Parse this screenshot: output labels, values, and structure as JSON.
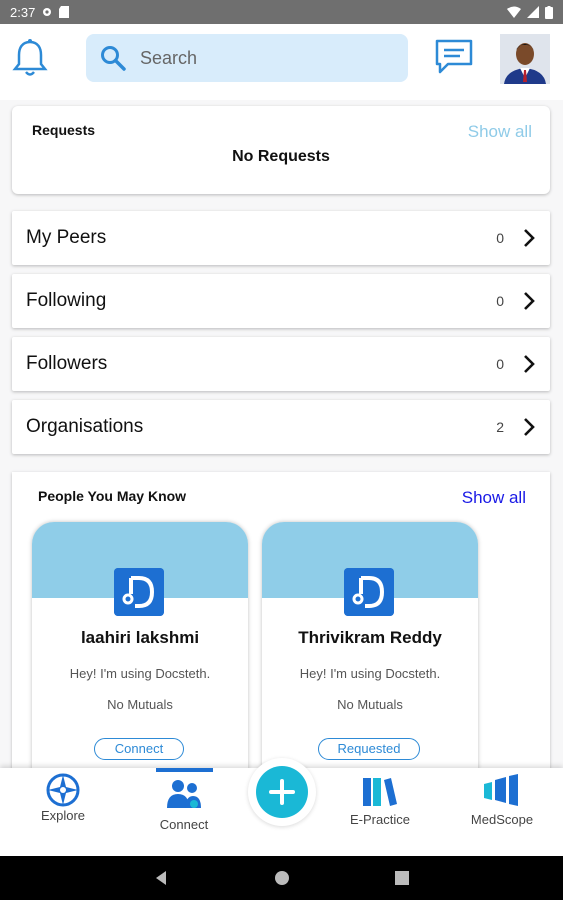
{
  "status_bar": {
    "time": "2:37"
  },
  "header": {
    "search_placeholder": "Search"
  },
  "requests": {
    "title": "Requests",
    "show_all": "Show all",
    "empty_text": "No Requests"
  },
  "connections": [
    {
      "label": "My Peers",
      "count": "0"
    },
    {
      "label": "Following",
      "count": "0"
    },
    {
      "label": "Followers",
      "count": "0"
    },
    {
      "label": "Organisations",
      "count": "2"
    }
  ],
  "people_you_may_know": {
    "title": "People You May Know",
    "show_all": "Show all",
    "people": [
      {
        "name": "laahiri lakshmi",
        "status": "Hey! I'm using Docsteth.",
        "mutuals": "No Mutuals",
        "action": "Connect"
      },
      {
        "name": "Thrivikram Reddy",
        "status": "Hey! I'm using Docsteth.",
        "mutuals": "No Mutuals",
        "action": "Requested"
      }
    ]
  },
  "bottom_nav": {
    "explore": "Explore",
    "connect": "Connect",
    "e_practice": "E-Practice",
    "medscope": "MedScope"
  },
  "colors": {
    "accent": "#1d6fd2",
    "light_blue": "#8fcde8",
    "fab": "#1ab8d6"
  }
}
